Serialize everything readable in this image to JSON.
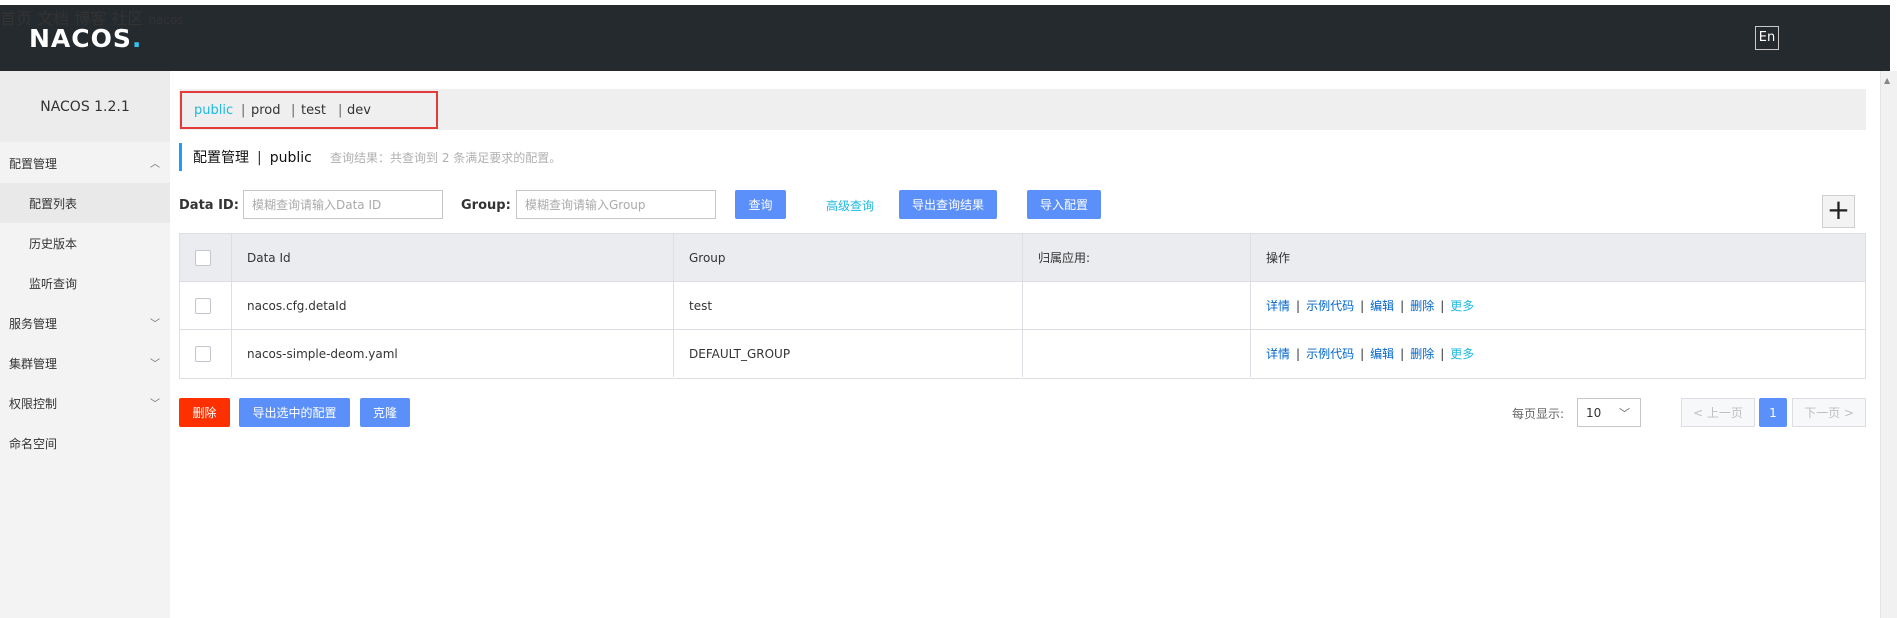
{
  "header": {
    "logo": "NACOS",
    "logo_dot": ".",
    "nav": [
      "首页",
      "文档",
      "博客",
      "社区"
    ],
    "lang": "En",
    "user": "nacos"
  },
  "sidebar": {
    "version": "NACOS 1.2.1",
    "groups": [
      {
        "label": "配置管理",
        "expanded": true,
        "children": [
          "配置列表",
          "历史版本",
          "监听查询"
        ]
      },
      {
        "label": "服务管理",
        "expanded": false
      },
      {
        "label": "集群管理",
        "expanded": false
      },
      {
        "label": "权限控制",
        "expanded": false
      },
      {
        "label": "命名空间"
      }
    ],
    "active_child": "配置列表"
  },
  "namespaces": {
    "items": [
      "public",
      "prod",
      "test",
      "dev"
    ],
    "separator": "|",
    "active": "public"
  },
  "page": {
    "title": "配置管理",
    "title_sep": "|",
    "namespace": "public",
    "result_desc": "查询结果：共查询到 2 条满足要求的配置。"
  },
  "search": {
    "data_id_label": "Data ID:",
    "data_id_placeholder": "模糊查询请输入Data ID",
    "group_label": "Group:",
    "group_placeholder": "模糊查询请输入Group",
    "query_btn": "查询",
    "advanced": "高级查询",
    "export_btn": "导出查询结果",
    "import_btn": "导入配置",
    "add_icon": "+"
  },
  "table": {
    "columns": [
      "Data Id",
      "Group",
      "归属应用:",
      "操作"
    ],
    "rows": [
      {
        "data_id": "nacos.cfg.detaId",
        "group": "test",
        "app": ""
      },
      {
        "data_id": "nacos-simple-deom.yaml",
        "group": "DEFAULT_GROUP",
        "app": ""
      }
    ],
    "ops": [
      "详情",
      "示例代码",
      "编辑",
      "删除",
      "更多"
    ],
    "op_sep": "|"
  },
  "footer": {
    "delete_btn": "删除",
    "export_selected_btn": "导出选中的配置",
    "clone_btn": "克隆",
    "page_size_label": "每页显示:",
    "page_size": "10",
    "prev": "< 上一页",
    "current_page": "1",
    "next": "下一页 >"
  },
  "colors": {
    "header_bg": "#252a2f",
    "accent": "#1db9e0",
    "primary": "#5b8ff9",
    "danger": "#ff3000",
    "highlight_box": "#e33b3b"
  }
}
